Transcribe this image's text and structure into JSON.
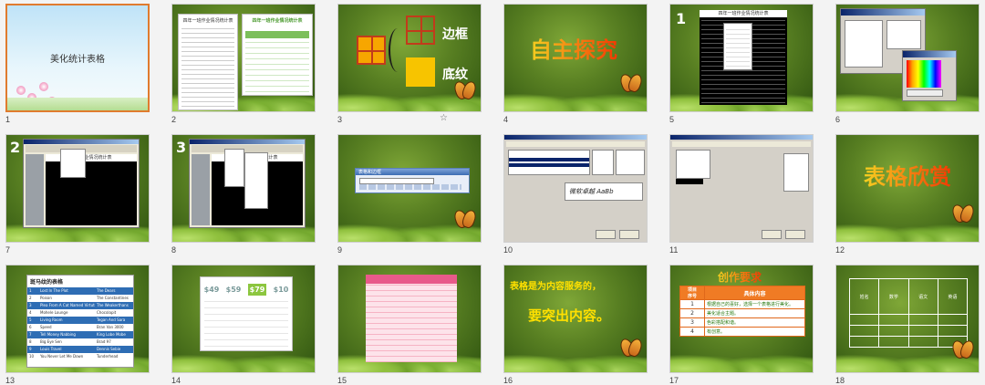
{
  "slides": [
    {
      "num": "1",
      "title": "美化统计表格"
    },
    {
      "num": "2",
      "doc_title_left": "四年一班作业情况统计表",
      "doc_title_right": "四年一班作业情况统计表"
    },
    {
      "num": "3",
      "label_border": "边框",
      "label_shade": "底纹"
    },
    {
      "num": "4",
      "heading": "自主探究"
    },
    {
      "num": "5",
      "overlay_num": "1",
      "doc_title": "四年一班作业情况统计表"
    },
    {
      "num": "6"
    },
    {
      "num": "7",
      "overlay_num": "2",
      "doc_title": "一班作业情况统计表"
    },
    {
      "num": "8",
      "overlay_num": "3",
      "doc_title": "一班作业情况统计表"
    },
    {
      "num": "9",
      "toolbar_title": "表格和边框"
    },
    {
      "num": "10",
      "preview_text": "微软卓越  AaBb"
    },
    {
      "num": "11"
    },
    {
      "num": "12",
      "heading": "表格欣赏"
    },
    {
      "num": "13",
      "table_title": "斑马纹的表格",
      "rows": [
        [
          "1",
          "Lost In The Plot",
          "The Dears"
        ],
        [
          "2",
          "Poison",
          "The Constantines"
        ],
        [
          "3",
          "Plea From A Cat Named Virtute",
          "The Weakerthans"
        ],
        [
          "4",
          "Mohele Lounge",
          "Chocolapit"
        ],
        [
          "5",
          "Living Room",
          "Tegan And Sara"
        ],
        [
          "6",
          "Speed",
          "Bran Van 3000"
        ],
        [
          "7",
          "Tell Money Nabbing",
          "King Lobe Mobe"
        ],
        [
          "8",
          "Big Eye Sen",
          "Brad 97"
        ],
        [
          "9",
          "Louis Travel",
          "Dennis Sebie"
        ],
        [
          "10",
          "You Never Let Me Down",
          "Tunderhead"
        ]
      ]
    },
    {
      "num": "14",
      "prices": [
        "$49",
        "$59",
        "$79",
        "$10"
      ]
    },
    {
      "num": "15"
    },
    {
      "num": "16",
      "line1": "表格是为内容服务的，",
      "line2": "要突出内容。"
    },
    {
      "num": "17",
      "heading": "创作要求",
      "col_seq": "序号",
      "col_item": "项目",
      "col_content": "具体内容",
      "rows": [
        {
          "n": "1",
          "text": "根据自己的喜好，选择一个表格进行美化。"
        },
        {
          "n": "2",
          "text": "美化适合主题。"
        },
        {
          "n": "3",
          "text": "色彩搭配和谐。"
        },
        {
          "n": "4",
          "text": "有创意。"
        }
      ]
    },
    {
      "num": "18",
      "headers": [
        "姓名",
        "数学",
        "语文",
        "英语"
      ]
    }
  ],
  "icons": {
    "star": "☆"
  },
  "colors": {
    "selected_border": "#e07b2e",
    "slide_bg_green": "#587f22",
    "orange": "#e0681a"
  }
}
